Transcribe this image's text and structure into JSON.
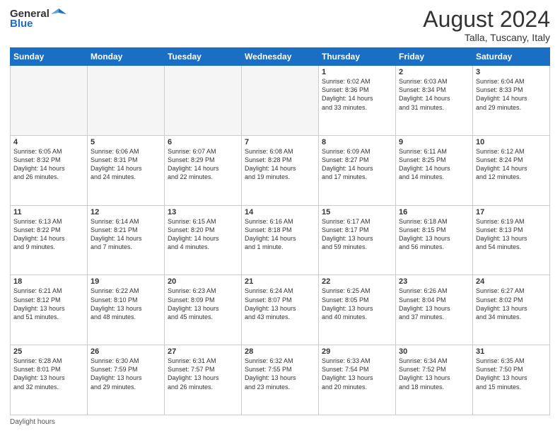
{
  "header": {
    "logo_general": "General",
    "logo_blue": "Blue",
    "month_year": "August 2024",
    "location": "Talla, Tuscany, Italy"
  },
  "columns": [
    "Sunday",
    "Monday",
    "Tuesday",
    "Wednesday",
    "Thursday",
    "Friday",
    "Saturday"
  ],
  "weeks": [
    [
      {
        "day": "",
        "info": "",
        "empty": true
      },
      {
        "day": "",
        "info": "",
        "empty": true
      },
      {
        "day": "",
        "info": "",
        "empty": true
      },
      {
        "day": "",
        "info": "",
        "empty": true
      },
      {
        "day": "1",
        "info": "Sunrise: 6:02 AM\nSunset: 8:36 PM\nDaylight: 14 hours\nand 33 minutes."
      },
      {
        "day": "2",
        "info": "Sunrise: 6:03 AM\nSunset: 8:34 PM\nDaylight: 14 hours\nand 31 minutes."
      },
      {
        "day": "3",
        "info": "Sunrise: 6:04 AM\nSunset: 8:33 PM\nDaylight: 14 hours\nand 29 minutes."
      }
    ],
    [
      {
        "day": "4",
        "info": "Sunrise: 6:05 AM\nSunset: 8:32 PM\nDaylight: 14 hours\nand 26 minutes."
      },
      {
        "day": "5",
        "info": "Sunrise: 6:06 AM\nSunset: 8:31 PM\nDaylight: 14 hours\nand 24 minutes."
      },
      {
        "day": "6",
        "info": "Sunrise: 6:07 AM\nSunset: 8:29 PM\nDaylight: 14 hours\nand 22 minutes."
      },
      {
        "day": "7",
        "info": "Sunrise: 6:08 AM\nSunset: 8:28 PM\nDaylight: 14 hours\nand 19 minutes."
      },
      {
        "day": "8",
        "info": "Sunrise: 6:09 AM\nSunset: 8:27 PM\nDaylight: 14 hours\nand 17 minutes."
      },
      {
        "day": "9",
        "info": "Sunrise: 6:11 AM\nSunset: 8:25 PM\nDaylight: 14 hours\nand 14 minutes."
      },
      {
        "day": "10",
        "info": "Sunrise: 6:12 AM\nSunset: 8:24 PM\nDaylight: 14 hours\nand 12 minutes."
      }
    ],
    [
      {
        "day": "11",
        "info": "Sunrise: 6:13 AM\nSunset: 8:22 PM\nDaylight: 14 hours\nand 9 minutes."
      },
      {
        "day": "12",
        "info": "Sunrise: 6:14 AM\nSunset: 8:21 PM\nDaylight: 14 hours\nand 7 minutes."
      },
      {
        "day": "13",
        "info": "Sunrise: 6:15 AM\nSunset: 8:20 PM\nDaylight: 14 hours\nand 4 minutes."
      },
      {
        "day": "14",
        "info": "Sunrise: 6:16 AM\nSunset: 8:18 PM\nDaylight: 14 hours\nand 1 minute."
      },
      {
        "day": "15",
        "info": "Sunrise: 6:17 AM\nSunset: 8:17 PM\nDaylight: 13 hours\nand 59 minutes."
      },
      {
        "day": "16",
        "info": "Sunrise: 6:18 AM\nSunset: 8:15 PM\nDaylight: 13 hours\nand 56 minutes."
      },
      {
        "day": "17",
        "info": "Sunrise: 6:19 AM\nSunset: 8:13 PM\nDaylight: 13 hours\nand 54 minutes."
      }
    ],
    [
      {
        "day": "18",
        "info": "Sunrise: 6:21 AM\nSunset: 8:12 PM\nDaylight: 13 hours\nand 51 minutes."
      },
      {
        "day": "19",
        "info": "Sunrise: 6:22 AM\nSunset: 8:10 PM\nDaylight: 13 hours\nand 48 minutes."
      },
      {
        "day": "20",
        "info": "Sunrise: 6:23 AM\nSunset: 8:09 PM\nDaylight: 13 hours\nand 45 minutes."
      },
      {
        "day": "21",
        "info": "Sunrise: 6:24 AM\nSunset: 8:07 PM\nDaylight: 13 hours\nand 43 minutes."
      },
      {
        "day": "22",
        "info": "Sunrise: 6:25 AM\nSunset: 8:05 PM\nDaylight: 13 hours\nand 40 minutes."
      },
      {
        "day": "23",
        "info": "Sunrise: 6:26 AM\nSunset: 8:04 PM\nDaylight: 13 hours\nand 37 minutes."
      },
      {
        "day": "24",
        "info": "Sunrise: 6:27 AM\nSunset: 8:02 PM\nDaylight: 13 hours\nand 34 minutes."
      }
    ],
    [
      {
        "day": "25",
        "info": "Sunrise: 6:28 AM\nSunset: 8:01 PM\nDaylight: 13 hours\nand 32 minutes."
      },
      {
        "day": "26",
        "info": "Sunrise: 6:30 AM\nSunset: 7:59 PM\nDaylight: 13 hours\nand 29 minutes."
      },
      {
        "day": "27",
        "info": "Sunrise: 6:31 AM\nSunset: 7:57 PM\nDaylight: 13 hours\nand 26 minutes."
      },
      {
        "day": "28",
        "info": "Sunrise: 6:32 AM\nSunset: 7:55 PM\nDaylight: 13 hours\nand 23 minutes."
      },
      {
        "day": "29",
        "info": "Sunrise: 6:33 AM\nSunset: 7:54 PM\nDaylight: 13 hours\nand 20 minutes."
      },
      {
        "day": "30",
        "info": "Sunrise: 6:34 AM\nSunset: 7:52 PM\nDaylight: 13 hours\nand 18 minutes."
      },
      {
        "day": "31",
        "info": "Sunrise: 6:35 AM\nSunset: 7:50 PM\nDaylight: 13 hours\nand 15 minutes."
      }
    ]
  ],
  "footer": {
    "note": "Daylight hours"
  }
}
